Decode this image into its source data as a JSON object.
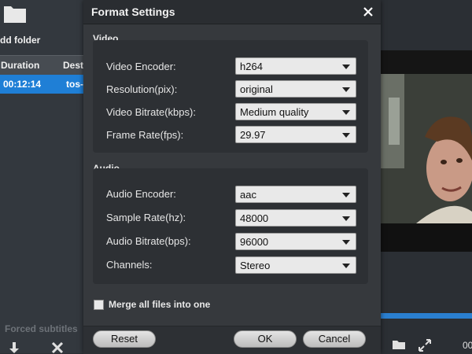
{
  "background": {
    "add_folder_label": "dd folder",
    "columns": {
      "duration": "Duration",
      "destination": "Dest"
    },
    "row": {
      "duration": "00:12:14",
      "destination": "tos-"
    },
    "forced_subtitles_label": "Forced subtitles",
    "preview_time": "00"
  },
  "dialog": {
    "title": "Format Settings",
    "video": {
      "section_label": "Video",
      "rows": [
        {
          "label": "Video Encoder:",
          "value": "h264"
        },
        {
          "label": "Resolution(pix):",
          "value": "original"
        },
        {
          "label": "Video Bitrate(kbps):",
          "value": "Medium quality"
        },
        {
          "label": "Frame Rate(fps):",
          "value": "29.97"
        }
      ]
    },
    "audio": {
      "section_label": "Audio",
      "rows": [
        {
          "label": "Audio Encoder:",
          "value": "aac"
        },
        {
          "label": "Sample Rate(hz):",
          "value": "48000"
        },
        {
          "label": "Audio Bitrate(bps):",
          "value": "96000"
        },
        {
          "label": "Channels:",
          "value": "Stereo"
        }
      ]
    },
    "merge": {
      "label": "Merge all files into one",
      "checked": false
    },
    "buttons": {
      "reset": "Reset",
      "ok": "OK",
      "cancel": "Cancel"
    }
  },
  "colors": {
    "dialog_bg": "#36393d",
    "selection_blue": "#1f7fd6",
    "progress_blue": "#2a7fd0"
  }
}
